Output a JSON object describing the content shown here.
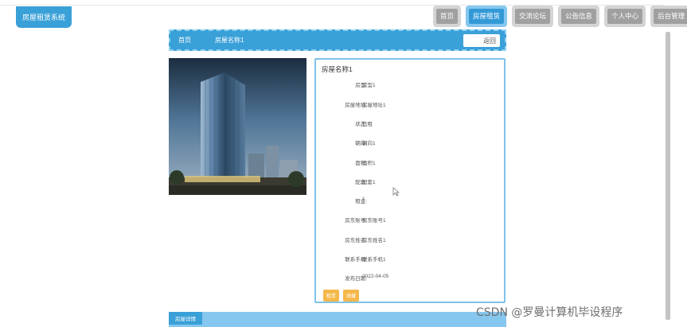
{
  "header": {
    "logo": "房屋租赁系统",
    "nav": [
      {
        "label": "首页",
        "active": false
      },
      {
        "label": "房屋租赁",
        "active": true
      },
      {
        "label": "交流论坛",
        "active": false
      },
      {
        "label": "公告信息",
        "active": false
      },
      {
        "label": "个人中心",
        "active": false
      },
      {
        "label": "后台管理",
        "active": false
      }
    ]
  },
  "breadcrumb": {
    "home": "首页",
    "current": "房屋名称1",
    "back_label": "返回"
  },
  "detail": {
    "title": "房屋名称1",
    "fields": [
      {
        "label": "房型:",
        "value": "房型1"
      },
      {
        "label": "房屋地址:",
        "value": "房屋地址1"
      },
      {
        "label": "状态:",
        "value": "已租"
      },
      {
        "label": "朝向:",
        "value": "朝向1"
      },
      {
        "label": "面积:",
        "value": "面积1"
      },
      {
        "label": "配套:",
        "value": "配套1"
      },
      {
        "label": "租金:",
        "value": "1"
      },
      {
        "label": "房东账号:",
        "value": "房东账号1"
      },
      {
        "label": "房东姓名:",
        "value": "房东姓名1"
      },
      {
        "label": "联系手机:",
        "value": "联系手机1"
      },
      {
        "label": "发布日期:",
        "value": "2022-04-05"
      }
    ],
    "buttons": {
      "first": "租赁",
      "second": "收藏"
    }
  },
  "bottom": {
    "tab": "房屋详情"
  },
  "watermark": "CSDN @罗曼计算机毕设程序",
  "colors": {
    "primary": "#3aa0d8",
    "accent": "#f5b84a",
    "light": "#86c7ef"
  }
}
